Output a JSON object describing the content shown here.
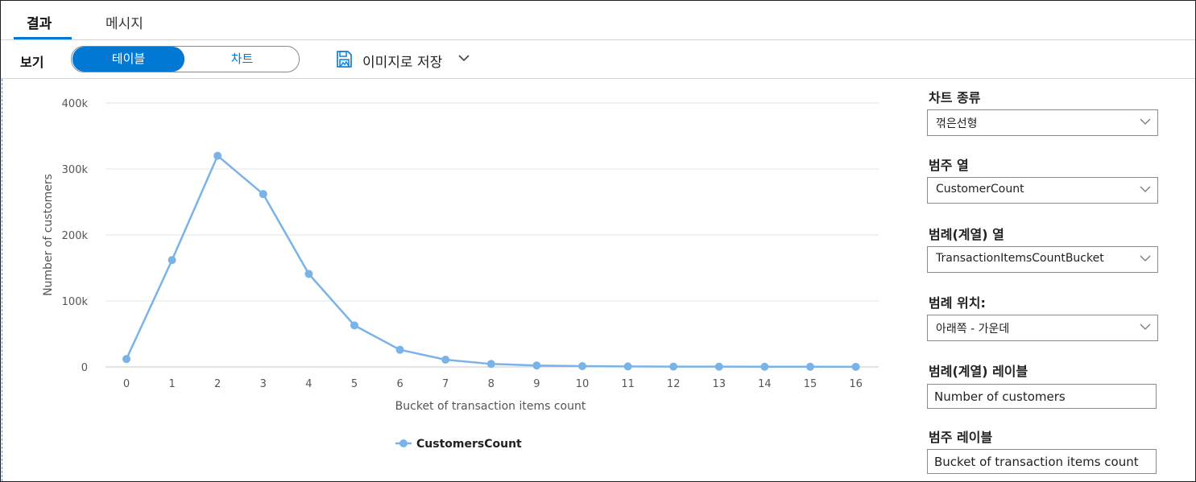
{
  "tabs": [
    {
      "label": "결과",
      "active": true
    },
    {
      "label": "메시지",
      "active": false
    }
  ],
  "view": {
    "label": "보기",
    "toggle": {
      "left": "테이블",
      "right": "차트"
    },
    "save_label": "이미지로 저장"
  },
  "panel": {
    "chart_type": {
      "label": "차트 종류",
      "value": "꺾은선형"
    },
    "category_column": {
      "label": "범주 열",
      "value": "CustomerCount"
    },
    "legend_series_column": {
      "label": "범례(계열) 열",
      "value": "TransactionItemsCountBucket"
    },
    "legend_position": {
      "label": "범례 위치:",
      "value": "아래쪽 - 가운데"
    },
    "legend_series_label": {
      "label": "범례(계열) 레이블",
      "value": "Number of customers"
    },
    "category_label": {
      "label": "범주 레이블",
      "value": "Bucket of transaction items count"
    }
  },
  "colors": {
    "accent": "#0078d4",
    "series": "#7ab3e8",
    "grid": "#e3e3e3"
  },
  "chart_data": {
    "type": "line",
    "x": [
      0,
      1,
      2,
      3,
      4,
      5,
      6,
      7,
      8,
      9,
      10,
      11,
      12,
      13,
      14,
      15,
      16
    ],
    "series": [
      {
        "name": "CustomersCount",
        "values": [
          12000,
          162000,
          320000,
          262000,
          141000,
          63000,
          26000,
          11000,
          4500,
          2200,
          1200,
          700,
          500,
          400,
          300,
          250,
          200
        ]
      }
    ],
    "ylim": [
      0,
      400000
    ],
    "yticks": [
      "0",
      "100k",
      "200k",
      "300k",
      "400k"
    ],
    "xlabel": "Bucket of transaction items count",
    "ylabel": "Number of customers",
    "legend": "bottom-center",
    "grid": true
  }
}
